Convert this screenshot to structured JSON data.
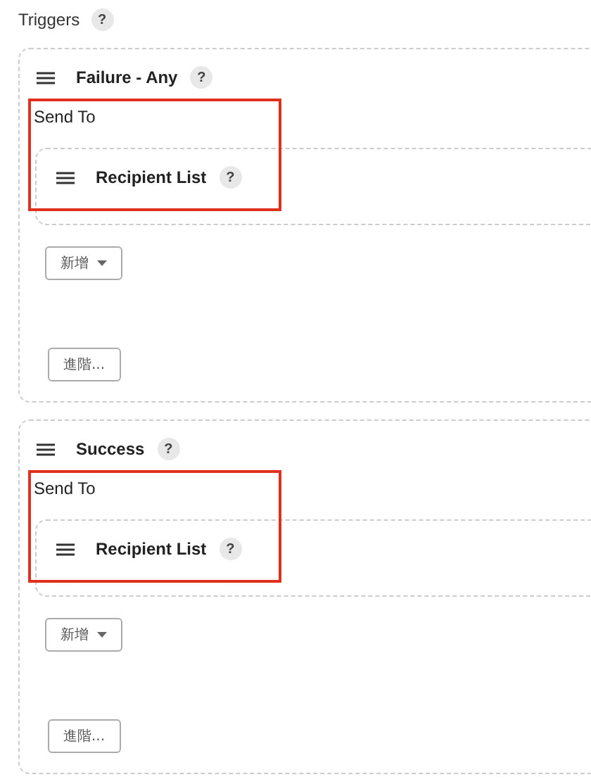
{
  "section": {
    "title": "Triggers",
    "help": "?"
  },
  "triggers": [
    {
      "title": "Failure - Any",
      "help": "?",
      "send_to": {
        "label": "Send To",
        "highlighted": true,
        "recipients": [
          {
            "title": "Recipient List",
            "help": "?"
          }
        ]
      },
      "add_button": "新增",
      "advanced_button": "進階..."
    },
    {
      "title": "Success",
      "help": "?",
      "send_to": {
        "label": "Send To",
        "highlighted": true,
        "recipients": [
          {
            "title": "Recipient List",
            "help": "?"
          }
        ]
      },
      "add_button": "新增",
      "advanced_button": "進階..."
    }
  ]
}
